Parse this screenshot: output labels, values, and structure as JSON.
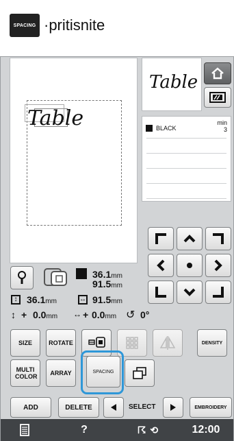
{
  "instruction": {
    "icon_label": "SPACING",
    "text": "·pritisnite"
  },
  "canvas": {
    "text": "Table"
  },
  "preview": {
    "text": "Table"
  },
  "colors": [
    {
      "name": "BLACK",
      "min_label": "min",
      "min_value": "3",
      "color": "#111111"
    }
  ],
  "info": {
    "width_value": "36.1",
    "height_value": "91.5",
    "unit": "mm",
    "size_width": "36.1",
    "size_height": "91.5",
    "offset_x": "0.0",
    "offset_y": "0.0",
    "angle": "0°",
    "plus": "+"
  },
  "tools": {
    "size": "SIZE",
    "rotate": "ROTATE",
    "density": "DENSITY",
    "multi_color": "MULTI COLOR",
    "array": "ARRAY",
    "spacing": "SPACING"
  },
  "bottom": {
    "add": "ADD",
    "delete": "DELETE",
    "select": "SELECT",
    "embroidery": "EMBROIDERY"
  },
  "status": {
    "help": "?",
    "time": "12:00"
  }
}
